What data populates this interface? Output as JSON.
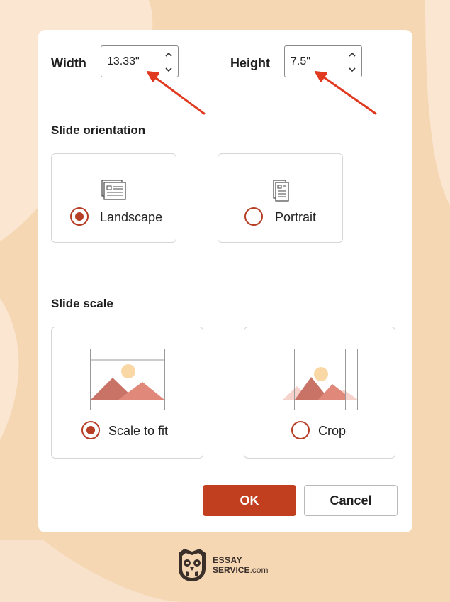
{
  "dialog": {
    "width_label": "Width",
    "width_value": "13.33\"",
    "height_label": "Height",
    "height_value": "7.5\""
  },
  "orientation": {
    "title": "Slide orientation",
    "options": [
      {
        "label": "Landscape",
        "selected": true
      },
      {
        "label": "Portrait",
        "selected": false
      }
    ]
  },
  "scale": {
    "title": "Slide scale",
    "options": [
      {
        "label": "Scale to fit",
        "selected": true
      },
      {
        "label": "Crop",
        "selected": false
      }
    ]
  },
  "buttons": {
    "ok_label": "OK",
    "cancel_label": "Cancel"
  },
  "branding": {
    "line1": "ESSAY",
    "line2": "SERVICE",
    "suffix": ".com"
  },
  "colors": {
    "accent": "#c13f1f",
    "background": "#f5d7b4",
    "arrow": "#e03a21"
  },
  "icons": [
    "chevron-up-icon",
    "chevron-down-icon",
    "landscape-slide-icon",
    "portrait-slide-icon",
    "scale-to-fit-image-icon",
    "crop-image-icon",
    "owl-logo-icon"
  ]
}
